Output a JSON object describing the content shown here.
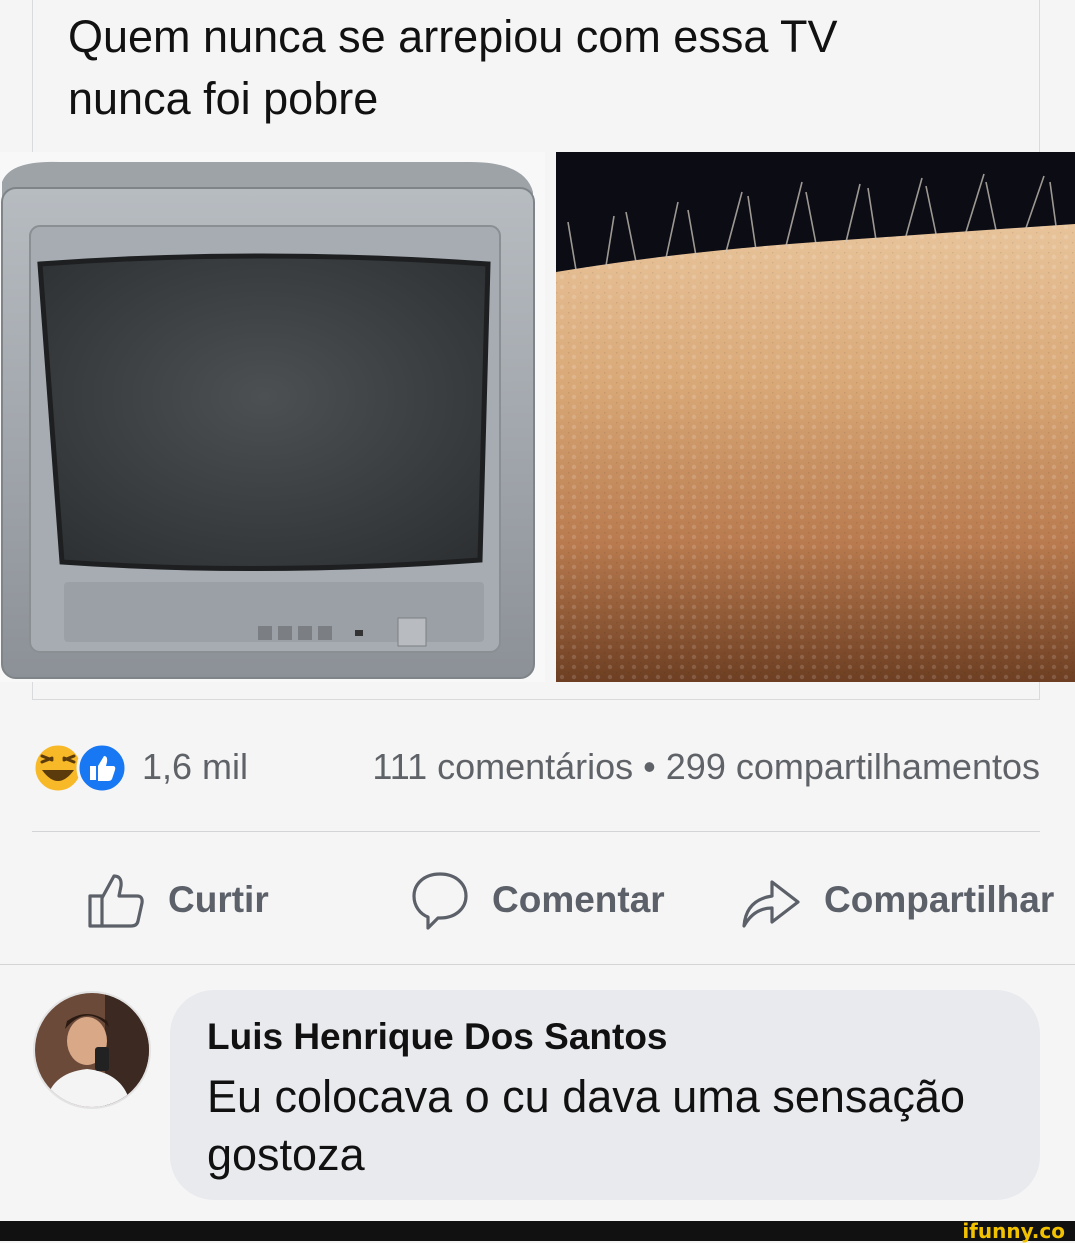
{
  "post": {
    "text": "Quem nunca se arrepiou com essa TV nunca foi pobre"
  },
  "stats": {
    "reactions": [
      "laughing-face-emoji",
      "like-thumb"
    ],
    "reaction_count": "1,6 mil",
    "comments_shares": "111 comentários • 299 compartilhamentos"
  },
  "actions": {
    "like_label": "Curtir",
    "comment_label": "Comentar",
    "share_label": "Compartilhar"
  },
  "comment": {
    "author": "Luis Henrique Dos Santos",
    "text": "Eu colocava o cu dava uma sensação gostoza"
  },
  "footer": {
    "watermark": "ifunny.co"
  },
  "colors": {
    "background": "#f5f5f6",
    "bubble": "#e9eaee",
    "like_blue": "#1877f2",
    "haha_yellow": "#f7b928",
    "watermark": "#f2c200"
  }
}
